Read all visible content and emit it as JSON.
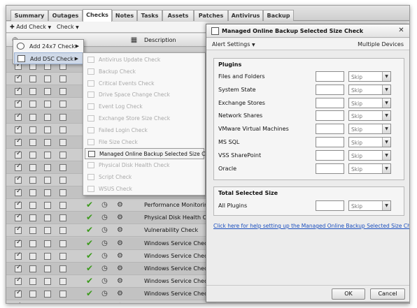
{
  "tabs": [
    {
      "label": "Summary"
    },
    {
      "label": "Outages"
    },
    {
      "label": "Checks"
    },
    {
      "label": "Notes"
    },
    {
      "label": "Tasks"
    },
    {
      "label": "Assets"
    },
    {
      "label": "Patches"
    },
    {
      "label": "Antivirus"
    },
    {
      "label": "Backup"
    }
  ],
  "active_tab": "Checks",
  "toolbar": {
    "add_check_label": "Add Check",
    "check_label": "Check"
  },
  "grid": {
    "description_header": "Description",
    "rows": [
      {
        "desc": ""
      },
      {
        "desc": ""
      },
      {
        "desc": ""
      },
      {
        "desc": ""
      },
      {
        "desc": ""
      },
      {
        "desc": ""
      },
      {
        "desc": ""
      },
      {
        "desc": ""
      },
      {
        "desc": ""
      },
      {
        "desc": ""
      },
      {
        "desc": ""
      },
      {
        "desc": "Performance Monitoring C"
      },
      {
        "desc": "Performance Monitoring C"
      },
      {
        "desc": "Physical Disk Health Chec"
      },
      {
        "desc": "Vulnerability Check"
      },
      {
        "desc": "Windows Service Check -"
      },
      {
        "desc": "Windows Service Check -"
      },
      {
        "desc": "Windows Service Check -"
      },
      {
        "desc": "Windows Service Check -"
      },
      {
        "desc": "Windows Service Check -"
      },
      {
        "desc": "Windows Service Check -"
      }
    ]
  },
  "add_menu": {
    "items": [
      {
        "label": "Add 24x7 Check"
      },
      {
        "label": "Add DSC Check"
      }
    ]
  },
  "dsc_menu": {
    "items": [
      {
        "label": "Antivirus Update Check"
      },
      {
        "label": "Backup Check"
      },
      {
        "label": "Critical Events Check"
      },
      {
        "label": "Drive Space Change Check"
      },
      {
        "label": "Event Log Check"
      },
      {
        "label": "Exchange Store Size Check"
      },
      {
        "label": "Failed Login Check"
      },
      {
        "label": "File Size Check"
      },
      {
        "label": "Managed Online Backup Selected Size Check"
      },
      {
        "label": "Physical Disk Health Check"
      },
      {
        "label": "Script Check"
      },
      {
        "label": "WSUS Check"
      }
    ],
    "highlighted_index": 8
  },
  "dialog": {
    "title": "Managed Online Backup Selected Size Check",
    "alert_settings": "Alert Settings",
    "multiple_devices": "Multiple Devices",
    "plugins_title": "Plugins",
    "plugins": [
      {
        "label": "Files and Folders",
        "value": "",
        "action": "Skip"
      },
      {
        "label": "System State",
        "value": "",
        "action": "Skip"
      },
      {
        "label": "Exchange Stores",
        "value": "",
        "action": "Skip"
      },
      {
        "label": "Network Shares",
        "value": "",
        "action": "Skip"
      },
      {
        "label": "VMware Virtual Machines",
        "value": "",
        "action": "Skip"
      },
      {
        "label": "MS SQL",
        "value": "",
        "action": "Skip"
      },
      {
        "label": "VSS SharePoint",
        "value": "",
        "action": "Skip"
      },
      {
        "label": "Oracle",
        "value": "",
        "action": "Skip"
      }
    ],
    "total_title": "Total Selected Size",
    "all_plugins": {
      "label": "All Plugins",
      "value": "",
      "action": "Skip"
    },
    "help_link": "Click here for help setting up the Managed Online Backup Selected Size Check",
    "ok_label": "OK",
    "cancel_label": "Cancel"
  },
  "colors": {
    "check_green": "#3b9a1b",
    "link_blue": "#1b4fbf"
  }
}
